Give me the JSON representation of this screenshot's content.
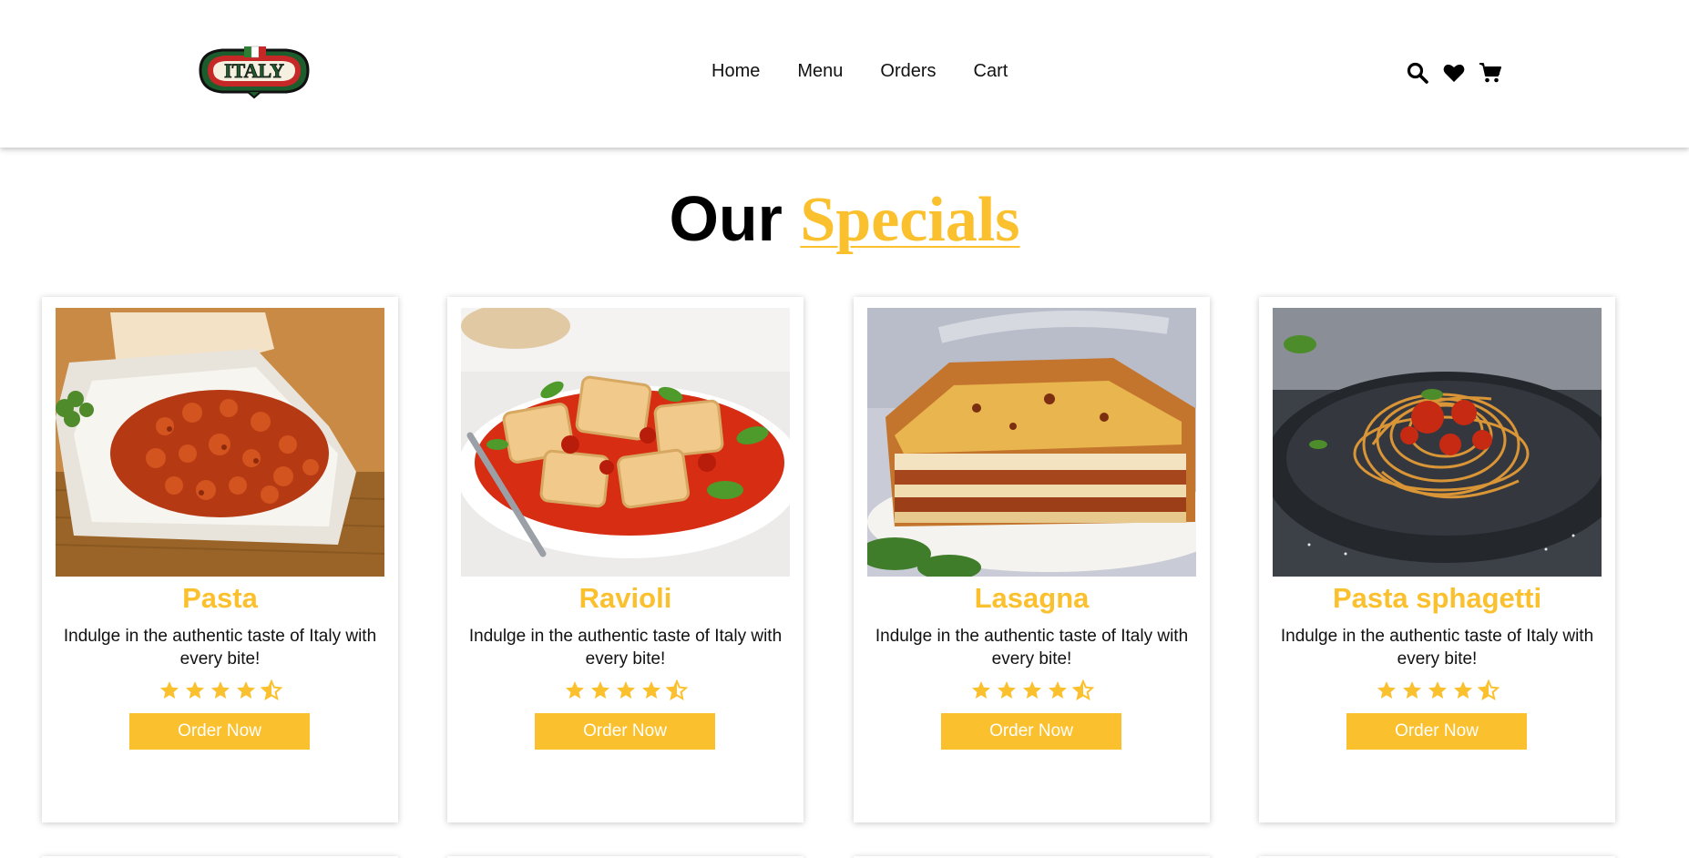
{
  "brand": {
    "logo_text": "ITALY"
  },
  "nav": {
    "items": [
      {
        "label": "Home"
      },
      {
        "label": "Menu"
      },
      {
        "label": "Orders"
      },
      {
        "label": "Cart"
      }
    ]
  },
  "header_icons": [
    "search-icon",
    "heart-icon",
    "cart-icon"
  ],
  "section": {
    "title_part1": "Our",
    "title_part2": "Specials"
  },
  "colors": {
    "accent": "#fbc02d",
    "text": "#000000",
    "background": "#ffffff"
  },
  "cards": [
    {
      "title": "Pasta",
      "description": "Indulge in the authentic taste of Italy with every bite!",
      "rating": 4.5,
      "button_label": "Order Now"
    },
    {
      "title": "Ravioli",
      "description": "Indulge in the authentic taste of Italy with every bite!",
      "rating": 4.5,
      "button_label": "Order Now"
    },
    {
      "title": "Lasagna",
      "description": "Indulge in the authentic taste of Italy with every bite!",
      "rating": 4.5,
      "button_label": "Order Now"
    },
    {
      "title": "Pasta sphagetti",
      "description": "Indulge in the authentic taste of Italy with every bite!",
      "rating": 4.5,
      "button_label": "Order Now"
    }
  ]
}
